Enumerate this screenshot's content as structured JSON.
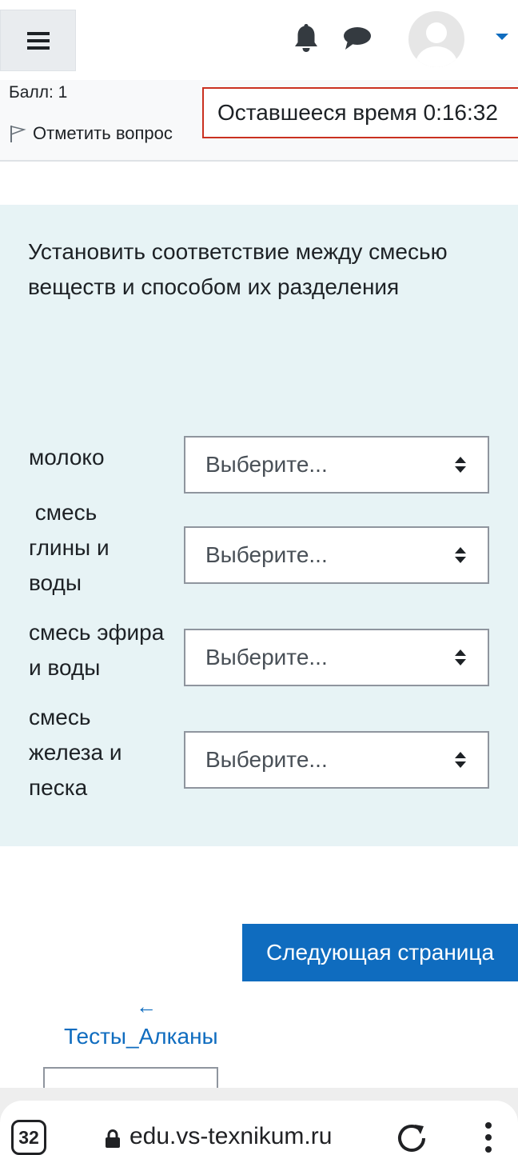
{
  "navbar": {
    "menu_icon": "hamburger-icon",
    "notifications_icon": "bell-icon",
    "messages_icon": "chat-icon",
    "user_icon": "avatar",
    "dropdown_icon": "caret-down-icon"
  },
  "info": {
    "score": "Балл: 1",
    "flag_label": "Отметить вопрос",
    "timer": "Оставшееся время 0:16:32"
  },
  "question": {
    "text": "Установить соответствие между смесью веществ и способом их разделения",
    "rows": [
      {
        "label": "молоко",
        "select_value": "Выберите..."
      },
      {
        "label": " смесь глины и воды",
        "select_value": "Выберите..."
      },
      {
        "label": "смесь эфира и воды",
        "select_value": "Выберите..."
      },
      {
        "label": "смесь железа и песка",
        "select_value": "Выберите..."
      }
    ]
  },
  "navigation": {
    "next_label": "Следующая страница",
    "prev_arrow": "←",
    "prev_label": "Тесты_Алканы"
  },
  "browser": {
    "tab_count": "32",
    "url": "edu.vs-texnikum.ru"
  },
  "colors": {
    "brand": "#0f6cbf",
    "question_bg": "#e7f3f5",
    "timer_border": "#ca3120"
  }
}
